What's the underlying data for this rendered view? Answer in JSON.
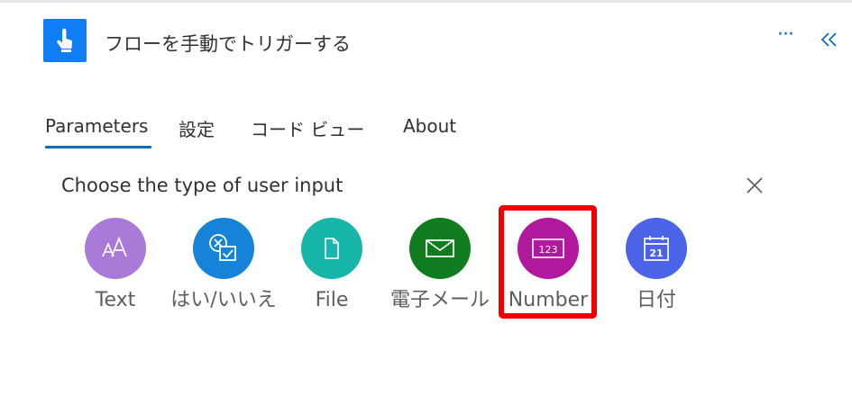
{
  "header": {
    "title": "フローを手動でトリガーする",
    "icon": "touch-hand-icon",
    "more_icon": "ellipsis-icon",
    "more_text": "···",
    "collapse_icon": "double-chevron-left-icon",
    "accent_color": "#0f7ef5"
  },
  "tabs": [
    {
      "label": "Parameters",
      "active": true
    },
    {
      "label": "設定",
      "active": false
    },
    {
      "label": "コード ビュー",
      "active": false
    },
    {
      "label": "About",
      "active": false
    }
  ],
  "panel": {
    "title": "Choose the type of user input",
    "close_icon": "close-icon"
  },
  "input_types": [
    {
      "label": "Text",
      "icon": "text-font-icon",
      "color": "#a97ad8"
    },
    {
      "label": "はい/いいえ",
      "icon": "yes-no-icon",
      "color": "#1683d8"
    },
    {
      "label": "File",
      "icon": "file-icon",
      "color": "#17b5aa"
    },
    {
      "label": "電子メール",
      "icon": "email-icon",
      "color": "#117b1f"
    },
    {
      "label": "Number",
      "icon": "number-icon",
      "color": "#b2189e",
      "highlighted": true
    },
    {
      "label": "日付",
      "icon": "calendar-icon",
      "color": "#4b63e6"
    }
  ],
  "highlight_color": "#f00000"
}
